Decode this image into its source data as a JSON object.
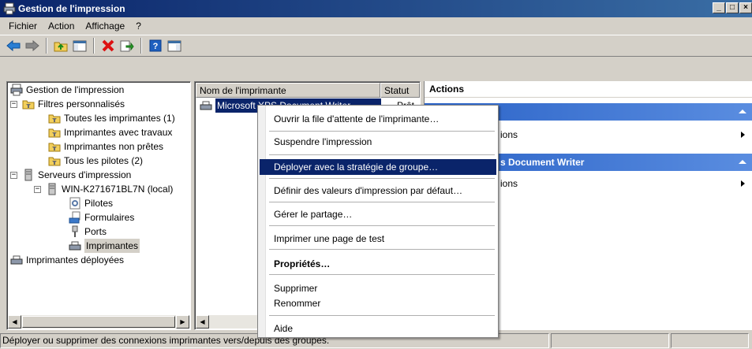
{
  "window": {
    "title": "Gestion de l'impression"
  },
  "menubar": [
    "Fichier",
    "Action",
    "Affichage",
    "?"
  ],
  "tree": {
    "items": [
      "Gestion de l'impression",
      "Filtres personnalisés",
      "Toutes les imprimantes (1)",
      "Imprimantes avec travaux",
      "Imprimantes non prêtes",
      "Tous les pilotes (2)",
      "Serveurs d'impression",
      "WIN-K271671BL7N (local)",
      "Pilotes",
      "Formulaires",
      "Ports",
      "Imprimantes",
      "Imprimantes déployées"
    ],
    "expander_minus": "−"
  },
  "list": {
    "columns": [
      "Nom de l'imprimante",
      "Statut"
    ],
    "rows": [
      {
        "name": "Microsoft XPS Document Writer",
        "status": "Prêt"
      }
    ]
  },
  "actions": {
    "header": "Actions",
    "section1_title": "",
    "section1_row": "ions",
    "section2_title": "s Document Writer",
    "section2_row": "ions"
  },
  "context_menu": {
    "items": [
      "Ouvrir la file d'attente de l'imprimante…",
      "Suspendre l'impression",
      "Déployer avec la stratégie de groupe…",
      "Définir des valeurs d'impression par défaut…",
      "Gérer le partage…",
      "Imprimer une page de test",
      "Propriétés…",
      "Supprimer",
      "Renommer",
      "Aide"
    ],
    "highlighted_index": 2
  },
  "statusbar": {
    "text": "Déployer ou supprimer des connexions imprimantes vers/depuis des groupes."
  },
  "colors": {
    "title_start": "#0a246a",
    "title_end": "#3a6ea5",
    "highlight": "#0a246a",
    "action_section": "#2b63c7"
  }
}
